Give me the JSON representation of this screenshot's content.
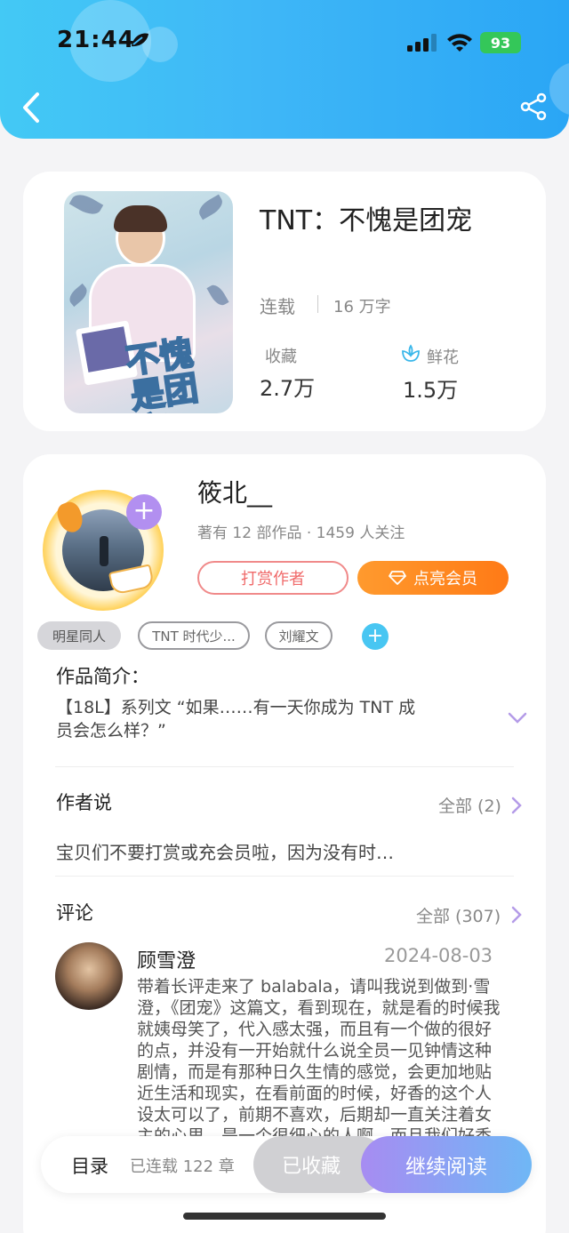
{
  "status_bar": {
    "time": "21:44",
    "battery": "93"
  },
  "book": {
    "title": "TNT：不愧是团宠",
    "status": "连载",
    "words": "16 万字",
    "favorites_label": "收藏",
    "favorites_value": "2.7万",
    "flowers_label": "鲜花",
    "flowers_value": "1.5万",
    "cover_art_text": "不愧是团宠"
  },
  "author": {
    "name": "筱北__",
    "meta": "著有 12 部作品 · 1459 人关注",
    "tip_button": "打赏作者",
    "vip_button": "点亮会员"
  },
  "tags": [
    "明星同人",
    "TNT 时代少...",
    "刘耀文"
  ],
  "intro": {
    "title": "作品简介：",
    "text": "【18L】系列文 “如果……有一天你成为 TNT 成员会怎么样？”"
  },
  "author_says": {
    "title": "作者说",
    "all_label": "全部 (2)",
    "text": "宝贝们不要打赏或充会员啦，因为没有时…"
  },
  "comments": {
    "title": "评论",
    "all_label": "全部 (307)",
    "items": [
      {
        "name": "顾雪澄",
        "date": "2024-08-03",
        "text": "带着长评走来了 balabala，请叫我说到做到·雪澄，《团宠》这篇文，看到现在，就是看的时候我就姨母笑了，代入感太强，而且有一个做的很好的点，并没有一开始就什么说全员一见钟情这种剧情，而是有那种日久生情的感觉，会更加地贴近生活和现实，在看前面的时候，好香的这个人设太可以了，前期不喜欢，后期却一直关注着女主的心思，是一个很细心的人啊，而且我们好香在现实也是一个很温柔细心"
      }
    ]
  },
  "bottom_bar": {
    "toc": "目录",
    "chapters": "已连载 122 章",
    "collected": "已收藏",
    "continue": "继续阅读"
  },
  "colors": {
    "header": "#3fb7f7",
    "accent_purple": "#a78cf2",
    "vip_orange": "#ff8a20",
    "tip_red": "#f06a6a"
  }
}
